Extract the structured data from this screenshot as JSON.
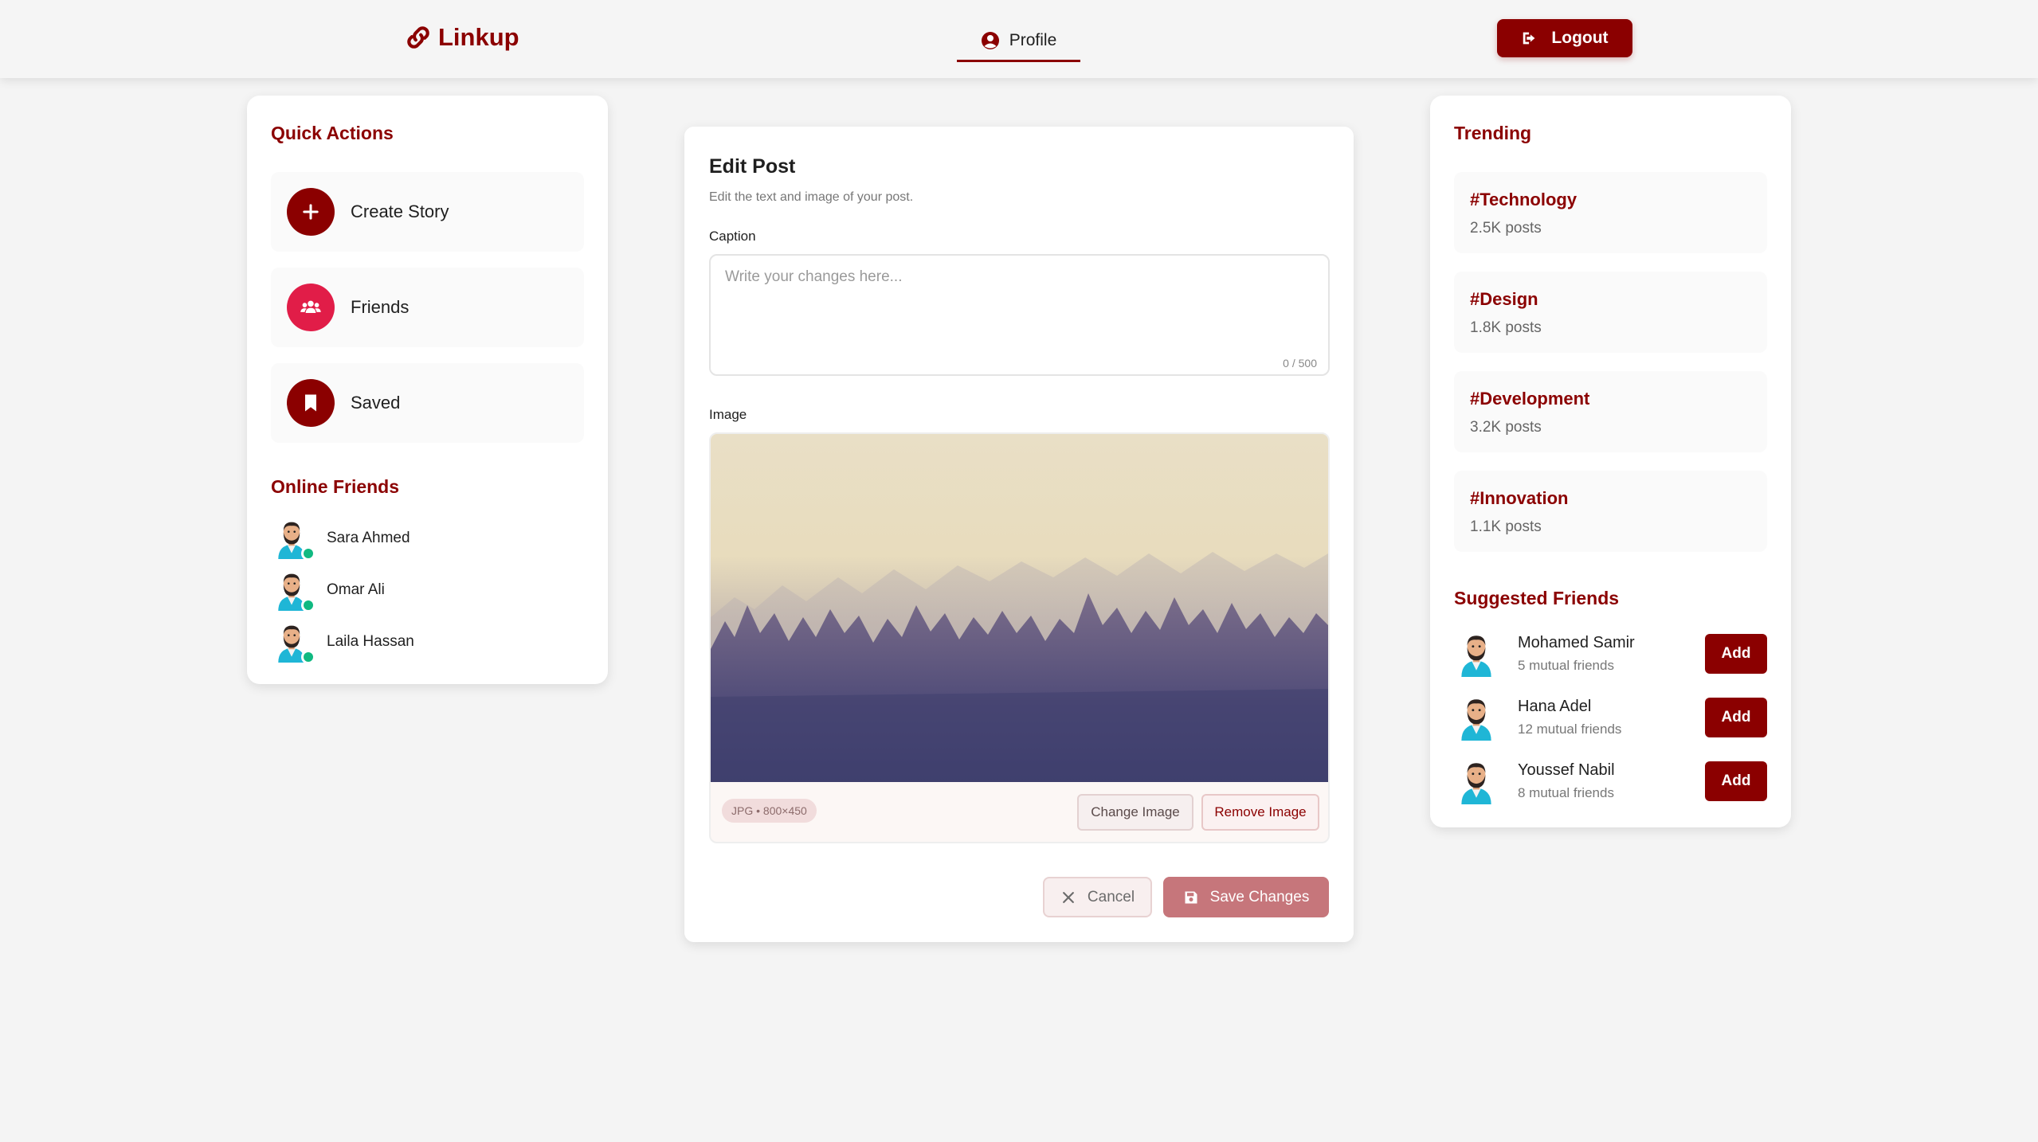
{
  "header": {
    "logo": "Linkup",
    "nav_profile": "Profile",
    "logout": "Logout"
  },
  "left": {
    "quick_actions_title": "Quick Actions",
    "quick_actions": [
      {
        "label": "Create Story",
        "icon": "plus-icon",
        "color": "#8b0000"
      },
      {
        "label": "Friends",
        "icon": "users-icon",
        "color": "#e11d48"
      },
      {
        "label": "Saved",
        "icon": "bookmark-icon",
        "color": "#8b0000"
      }
    ],
    "online_title": "Online Friends",
    "online_friends": [
      "Sara Ahmed",
      "Omar Ali",
      "Laila Hassan"
    ]
  },
  "edit": {
    "title": "Edit Post",
    "subtitle": "Edit the text and image of your post.",
    "caption_label": "Caption",
    "caption_value": "",
    "caption_placeholder": "Write your changes here...",
    "char_count": "0 / 500",
    "image_label": "Image",
    "image_meta": "JPG • 800×450",
    "change_image": "Change Image",
    "remove_image": "Remove Image",
    "cancel": "Cancel",
    "save": "Save Changes"
  },
  "right": {
    "trending_title": "Trending",
    "trending": [
      {
        "tag": "#Technology",
        "count": "2.5K posts"
      },
      {
        "tag": "#Design",
        "count": "1.8K posts"
      },
      {
        "tag": "#Development",
        "count": "3.2K posts"
      },
      {
        "tag": "#Innovation",
        "count": "1.1K posts"
      }
    ],
    "suggested_title": "Suggested Friends",
    "suggested": [
      {
        "name": "Mohamed Samir",
        "mutual": "5 mutual friends",
        "add": "Add"
      },
      {
        "name": "Hana Adel",
        "mutual": "12 mutual friends",
        "add": "Add"
      },
      {
        "name": "Youssef Nabil",
        "mutual": "8 mutual friends",
        "add": "Add"
      }
    ]
  },
  "colors": {
    "brand": "#8b0000",
    "accent_pink": "#e11d48",
    "online": "#10b981",
    "save_disabled": "#c6767b"
  }
}
